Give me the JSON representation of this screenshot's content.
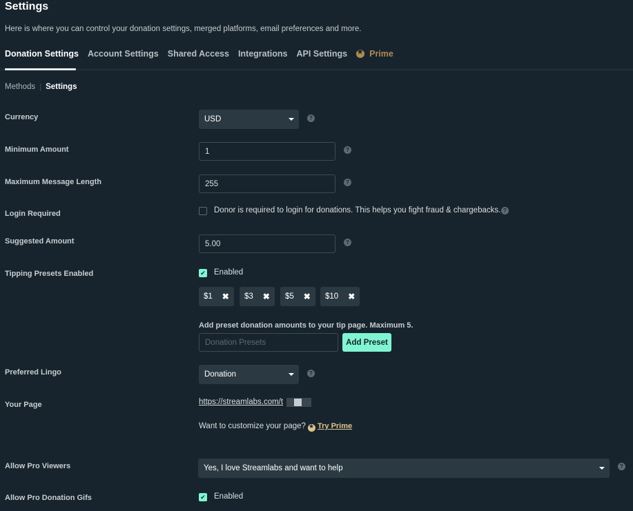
{
  "header": {
    "title": "Settings",
    "subtitle": "Here is where you can control your donation settings, merged platforms, email preferences and more."
  },
  "tabs": [
    {
      "label": "Donation Settings",
      "active": true
    },
    {
      "label": "Account Settings"
    },
    {
      "label": "Shared Access"
    },
    {
      "label": "Integrations"
    },
    {
      "label": "API Settings"
    },
    {
      "label": "Prime",
      "icon": "prime-star-icon"
    }
  ],
  "subnav": [
    {
      "label": "Methods"
    },
    {
      "label": "Settings",
      "active": true
    }
  ],
  "form": {
    "currency": {
      "label": "Currency",
      "value": "USD"
    },
    "minimum_amount": {
      "label": "Minimum Amount",
      "value": "1"
    },
    "max_message_length": {
      "label": "Maximum Message Length",
      "value": "255"
    },
    "login_required": {
      "label": "Login Required",
      "checked": false,
      "text": "Donor is required to login for donations. This helps you fight fraud & chargebacks."
    },
    "suggested_amount": {
      "label": "Suggested Amount",
      "value": "5.00"
    },
    "tipping_presets": {
      "label": "Tipping Presets Enabled",
      "checked": true,
      "checkbox_text": "Enabled",
      "presets": [
        "$1",
        "$3",
        "$5",
        "$10"
      ],
      "remove_glyph": "✖",
      "hint": "Add preset donation amounts to your tip page. Maximum 5.",
      "input_placeholder": "Donation Presets",
      "input_value": "",
      "add_button": "Add Preset"
    },
    "preferred_lingo": {
      "label": "Preferred Lingo",
      "value": "Donation"
    },
    "your_page": {
      "label": "Your Page",
      "url": "https://streamlabs.com/t",
      "customize_text": "Want to customize your page?",
      "try_prime": "Try Prime"
    },
    "allow_pro_viewers": {
      "label": "Allow Pro Viewers",
      "value": "Yes, I love Streamlabs and want to help"
    },
    "allow_pro_gifs": {
      "label": "Allow Pro Donation Gifs",
      "checked": true,
      "checkbox_text": "Enabled"
    }
  },
  "help_glyph": "?",
  "colors": {
    "background": "#17242d",
    "accent": "#80f5d2",
    "prime": "#b08a4f",
    "control": "#2b3a42"
  }
}
